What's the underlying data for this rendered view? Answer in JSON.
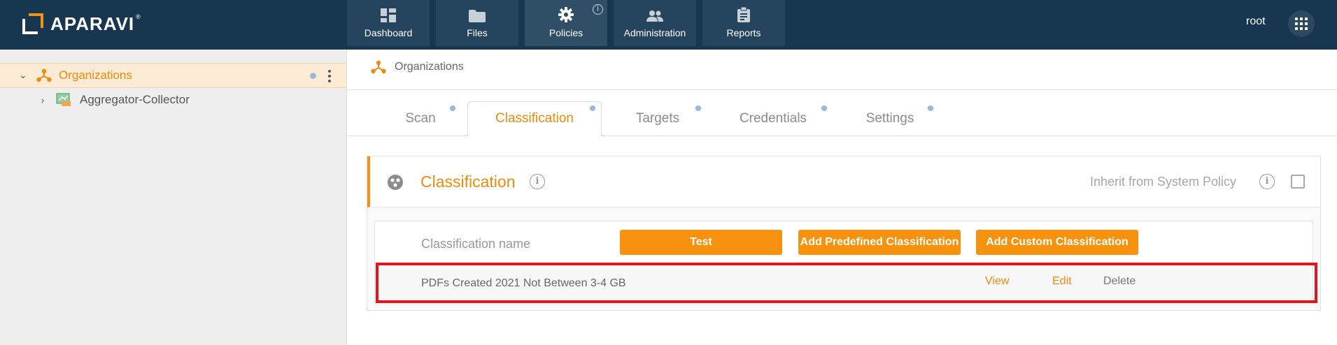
{
  "brand": {
    "name": "APARAVI",
    "mark": "®",
    "accent": "#f39112",
    "header_bg": "#17364f"
  },
  "nav": {
    "tabs": [
      {
        "label": "Dashboard",
        "icon": "dashboard-icon"
      },
      {
        "label": "Files",
        "icon": "folder-icon"
      },
      {
        "label": "Policies",
        "icon": "gear-icon",
        "active": true,
        "info": "i"
      },
      {
        "label": "Administration",
        "icon": "users-icon"
      },
      {
        "label": "Reports",
        "icon": "clipboard-icon"
      }
    ],
    "user": "root"
  },
  "sidebar": {
    "items": [
      {
        "label": "Organizations",
        "icon": "organization-icon",
        "expanded": true,
        "selected": true
      },
      {
        "label": "Aggregator-Collector",
        "icon": "aggregator-icon",
        "expanded": false
      }
    ]
  },
  "breadcrumb": {
    "label": "Organizations",
    "icon": "organization-icon"
  },
  "policy_tabs": [
    {
      "label": "Scan"
    },
    {
      "label": "Classification",
      "active": true
    },
    {
      "label": "Targets"
    },
    {
      "label": "Credentials"
    },
    {
      "label": "Settings"
    }
  ],
  "panel": {
    "title": "Classification",
    "inherit_label": "Inherit from System Policy",
    "inherit_checked": false,
    "info": "i"
  },
  "table": {
    "column_header": "Classification name",
    "buttons": {
      "test": "Test",
      "add_predefined": "Add Predefined Classification",
      "add_custom": "Add Custom Classification"
    },
    "rows": [
      {
        "name": "PDFs Created 2021 Not Between 3-4 GB",
        "actions": {
          "view": "View",
          "edit": "Edit",
          "delete": "Delete"
        }
      }
    ]
  }
}
